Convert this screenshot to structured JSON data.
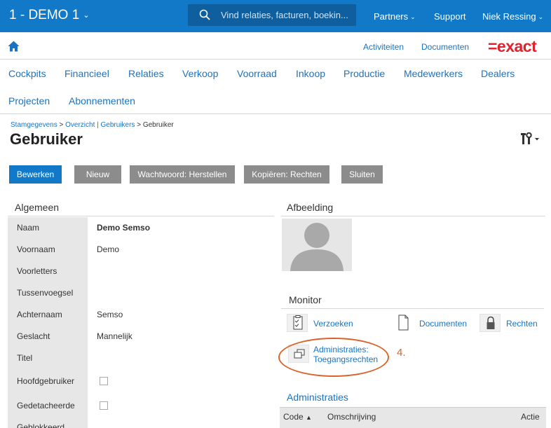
{
  "topbar": {
    "company": "1 - DEMO 1",
    "search_placeholder": "Vind relaties, facturen, boekin...",
    "partners": "Partners",
    "support": "Support",
    "user": "Niek Ressing"
  },
  "secondary": {
    "activiteiten": "Activiteiten",
    "documenten": "Documenten",
    "logo": "=exact"
  },
  "mainnav": [
    "Cockpits",
    "Financieel",
    "Relaties",
    "Verkoop",
    "Voorraad",
    "Inkoop",
    "Productie",
    "Medewerkers",
    "Dealers",
    "Projecten",
    "Abonnementen"
  ],
  "breadcrumb": {
    "stamgegevens": "Stamgegevens",
    "sep1": " > ",
    "overzicht": "Overzicht | Gebruikers",
    "sep2": " > ",
    "current": "Gebruiker"
  },
  "page_title": "Gebruiker",
  "buttons": {
    "bewerken": "Bewerken",
    "nieuw": "Nieuw",
    "wachtwoord": "Wachtwoord: Herstellen",
    "kopieren": "Kopiëren: Rechten",
    "sluiten": "Sluiten"
  },
  "algemeen": {
    "heading": "Algemeen",
    "fields": [
      {
        "label": "Naam",
        "value": "Demo Semso"
      },
      {
        "label": "Voornaam",
        "value": "Demo"
      },
      {
        "label": "Voorletters",
        "value": ""
      },
      {
        "label": "Tussenvoegsel",
        "value": ""
      },
      {
        "label": "Achternaam",
        "value": "Semso"
      },
      {
        "label": "Geslacht",
        "value": "Mannelijk"
      },
      {
        "label": "Titel",
        "value": ""
      },
      {
        "label": "Hoofdgebruiker",
        "value": ""
      },
      {
        "label": "Gedetacheerde",
        "value": ""
      },
      {
        "label": "Geblokkeerd",
        "value": ""
      }
    ]
  },
  "afbeelding": {
    "heading": "Afbeelding"
  },
  "monitor": {
    "heading": "Monitor",
    "verzoeken": "Verzoeken",
    "documenten": "Documenten",
    "rechten": "Rechten",
    "adm_line1": "Administraties:",
    "adm_line2": "Toegangsrechten",
    "callout_number": "4."
  },
  "administraties": {
    "heading": "Administraties",
    "columns": {
      "code": "Code",
      "omschrijving": "Omschrijving",
      "actie": "Actie"
    }
  },
  "colors": {
    "brand_blue": "#1179c8",
    "link_blue": "#1a73c2",
    "exact_red": "#e0222f",
    "callout_orange": "#d9642a"
  }
}
